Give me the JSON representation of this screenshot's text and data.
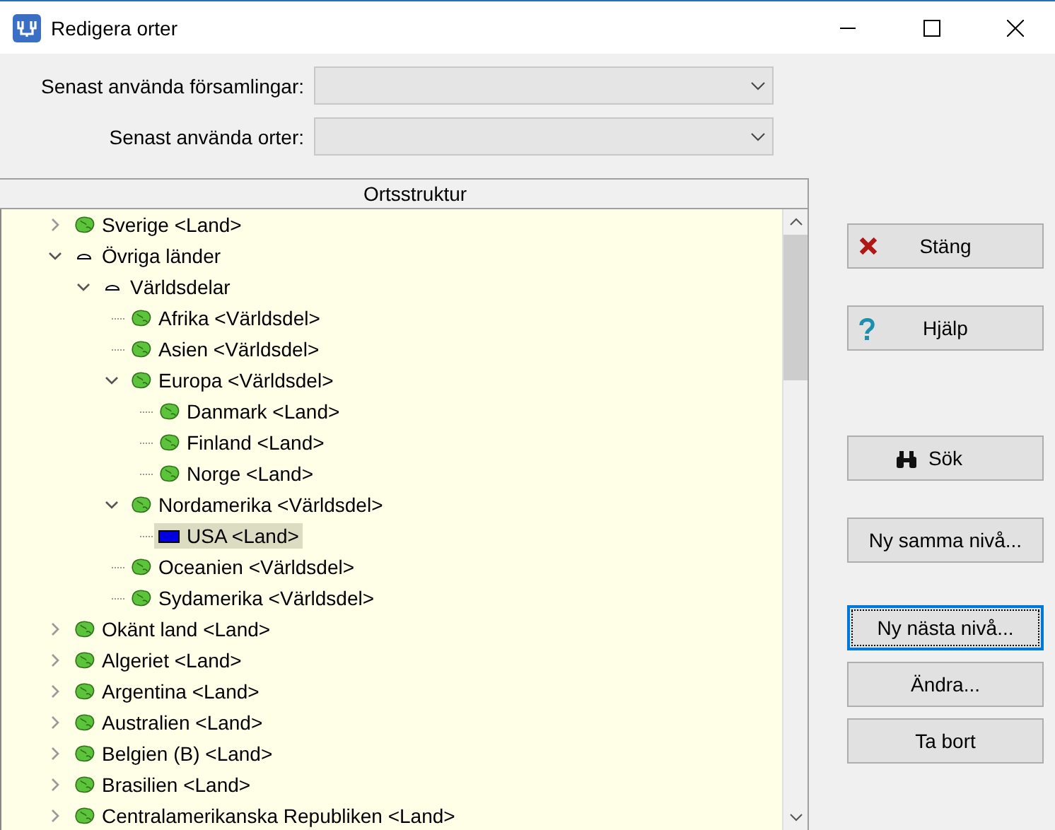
{
  "window": {
    "title": "Redigera orter"
  },
  "combos": [
    {
      "label": "Senast använda församlingar:"
    },
    {
      "label": "Senast använda orter:"
    }
  ],
  "tree": {
    "header": "Ortsstruktur",
    "items": [
      {
        "label": "Sverige <Land>",
        "kind": "globe",
        "expanded": false,
        "selected": false
      },
      {
        "label": "Övriga länder",
        "kind": "dome",
        "expanded": true,
        "selected": false,
        "children": [
          {
            "label": "Världsdelar",
            "kind": "dome",
            "expanded": true,
            "selected": false,
            "children": [
              {
                "label": "Afrika <Världsdel>",
                "kind": "globe",
                "selected": false
              },
              {
                "label": "Asien <Världsdel>",
                "kind": "globe",
                "selected": false
              },
              {
                "label": "Europa <Världsdel>",
                "kind": "globe",
                "expanded": true,
                "selected": false,
                "children": [
                  {
                    "label": "Danmark <Land>",
                    "kind": "globe",
                    "selected": false
                  },
                  {
                    "label": "Finland <Land>",
                    "kind": "globe",
                    "selected": false
                  },
                  {
                    "label": "Norge <Land>",
                    "kind": "globe",
                    "selected": false
                  }
                ]
              },
              {
                "label": "Nordamerika <Världsdel>",
                "kind": "globe",
                "expanded": true,
                "selected": false,
                "children": [
                  {
                    "label": "USA <Land>",
                    "kind": "flag",
                    "selected": true
                  }
                ]
              },
              {
                "label": "Oceanien <Världsdel>",
                "kind": "globe",
                "selected": false
              },
              {
                "label": "Sydamerika <Världsdel>",
                "kind": "globe",
                "selected": false
              }
            ]
          }
        ]
      },
      {
        "label": "Okänt land <Land>",
        "kind": "globe",
        "expanded": false,
        "selected": false
      },
      {
        "label": "Algeriet <Land>",
        "kind": "globe",
        "expanded": false,
        "selected": false
      },
      {
        "label": "Argentina <Land>",
        "kind": "globe",
        "expanded": false,
        "selected": false
      },
      {
        "label": "Australien <Land>",
        "kind": "globe",
        "expanded": false,
        "selected": false
      },
      {
        "label": "Belgien (B) <Land>",
        "kind": "globe",
        "expanded": false,
        "selected": false
      },
      {
        "label": "Brasilien <Land>",
        "kind": "globe",
        "expanded": false,
        "selected": false
      },
      {
        "label": "Centralamerikanska Republiken <Land>",
        "kind": "globe",
        "expanded": false,
        "selected": false
      }
    ]
  },
  "buttons": [
    {
      "label": "Stäng",
      "kind": "close",
      "focused": false
    },
    {
      "label": "Hjälp",
      "kind": "help",
      "focused": false
    },
    {
      "label": "Sök",
      "kind": "search",
      "focused": false
    },
    {
      "label": "Ny samma nivå...",
      "kind": "plain",
      "focused": false
    },
    {
      "label": "Ny nästa nivå...",
      "kind": "plain",
      "focused": true
    },
    {
      "label": "Ändra...",
      "kind": "plain",
      "focused": false
    },
    {
      "label": "Ta bort",
      "kind": "plain",
      "focused": false
    }
  ]
}
